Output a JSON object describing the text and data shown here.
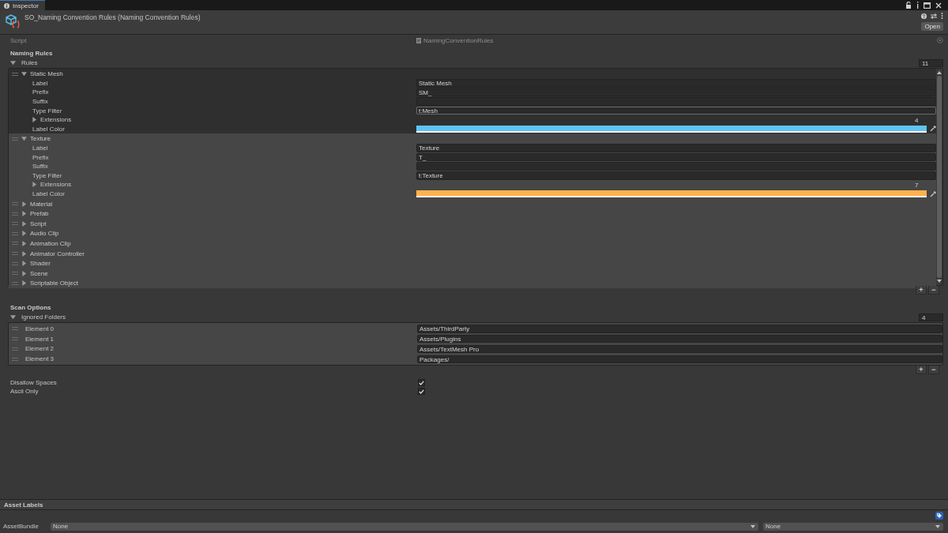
{
  "tab": {
    "title": "Inspector"
  },
  "header": {
    "title": "SO_Naming Convention Rules (Naming Convention Rules)",
    "open_button": "Open"
  },
  "script_field": {
    "label": "Script",
    "value": "NamingConventionRules",
    "disabled": true
  },
  "naming_rules": {
    "heading": "Naming Rules",
    "list_label": "Rules",
    "expanded": true,
    "count": "11",
    "items": [
      {
        "name": "Static Mesh",
        "expanded": true,
        "selected": true,
        "fields": [
          {
            "kind": "text",
            "label": "Label",
            "value": "Static Mesh",
            "focused": false
          },
          {
            "kind": "text",
            "label": "Prefix",
            "value": "SM_",
            "focused": false
          },
          {
            "kind": "text",
            "label": "Suffix",
            "focused": false
          },
          {
            "kind": "text",
            "label": "Type Filter",
            "value": "t:Mesh",
            "focused": true
          },
          {
            "kind": "foldout",
            "label": "Extensions",
            "expanded": false,
            "count": "4"
          },
          {
            "kind": "color",
            "label": "Label Color",
            "color": "#5ec4f5"
          }
        ]
      },
      {
        "name": "Texture",
        "expanded": true,
        "selected": false,
        "fields": [
          {
            "kind": "text",
            "label": "Label",
            "value": "Texture",
            "focused": false
          },
          {
            "kind": "text",
            "label": "Prefix",
            "value": "T_",
            "focused": false
          },
          {
            "kind": "text",
            "label": "Suffix",
            "focused": false
          },
          {
            "kind": "text",
            "label": "Type Filter",
            "value": "t:Texture",
            "focused": false
          },
          {
            "kind": "foldout",
            "label": "Extensions",
            "expanded": false,
            "count": "7"
          },
          {
            "kind": "color",
            "label": "Label Color",
            "color": "#ffb24d"
          }
        ]
      },
      {
        "name": "Material",
        "expanded": false,
        "selected": false
      },
      {
        "name": "Prefab",
        "expanded": false,
        "selected": false
      },
      {
        "name": "Script",
        "expanded": false,
        "selected": false
      },
      {
        "name": "Audio Clip",
        "expanded": false,
        "selected": false
      },
      {
        "name": "Animation Clip",
        "expanded": false,
        "selected": false
      },
      {
        "name": "Animator Controller",
        "expanded": false,
        "selected": false
      },
      {
        "name": "Shader",
        "expanded": false,
        "selected": false
      },
      {
        "name": "Scene",
        "expanded": false,
        "selected": false
      },
      {
        "name": "Scriptable Object",
        "expanded": false,
        "selected": false
      }
    ],
    "add_button": "+",
    "remove_button": "−"
  },
  "scan_options": {
    "heading": "Scan Options",
    "list_label": "Ignored Folders",
    "expanded": true,
    "count": "4",
    "items": [
      {
        "label": "Element 0",
        "value": "Assets/ThirdParty"
      },
      {
        "label": "Element 1",
        "value": "Assets/Plugins"
      },
      {
        "label": "Element 2",
        "value": "Assets/TextMesh Pro"
      },
      {
        "label": "Element 3",
        "value": "Packages/"
      }
    ],
    "add_button": "+",
    "remove_button": "−",
    "toggles": [
      {
        "label": "Disallow Spaces",
        "checked": true
      },
      {
        "label": "Ascii Only",
        "checked": true
      }
    ]
  },
  "footer": {
    "asset_labels": "Asset Labels",
    "asset_bundle_label": "AssetBundle",
    "bundle": "None",
    "variant": "None"
  }
}
